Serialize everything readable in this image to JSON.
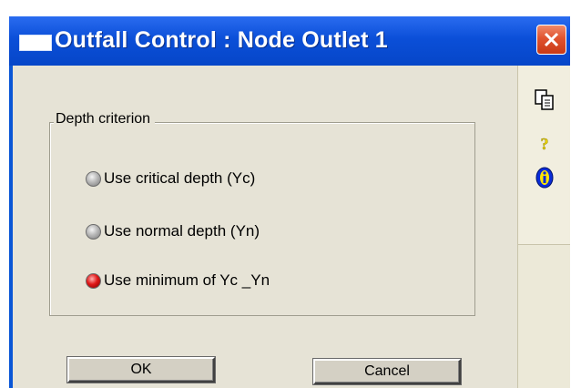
{
  "window": {
    "title": "Outfall Control : Node Outlet 1"
  },
  "group": {
    "legend": "Depth criterion"
  },
  "options": [
    {
      "label": "Use critical depth (Yc)",
      "selected": false
    },
    {
      "label": "Use normal depth (Yn)",
      "selected": false
    },
    {
      "label": "Use minimum of Yc _Yn",
      "selected": true
    }
  ],
  "buttons": {
    "ok": "OK",
    "cancel": "Cancel"
  },
  "sidebar": {
    "icons": [
      "copy-icon",
      "help-icon",
      "info-icon"
    ]
  },
  "colors": {
    "titlebar": "#0a56d6",
    "close": "#e0532f",
    "client": "#e6e3d6",
    "radio_selected": "#e01818"
  }
}
